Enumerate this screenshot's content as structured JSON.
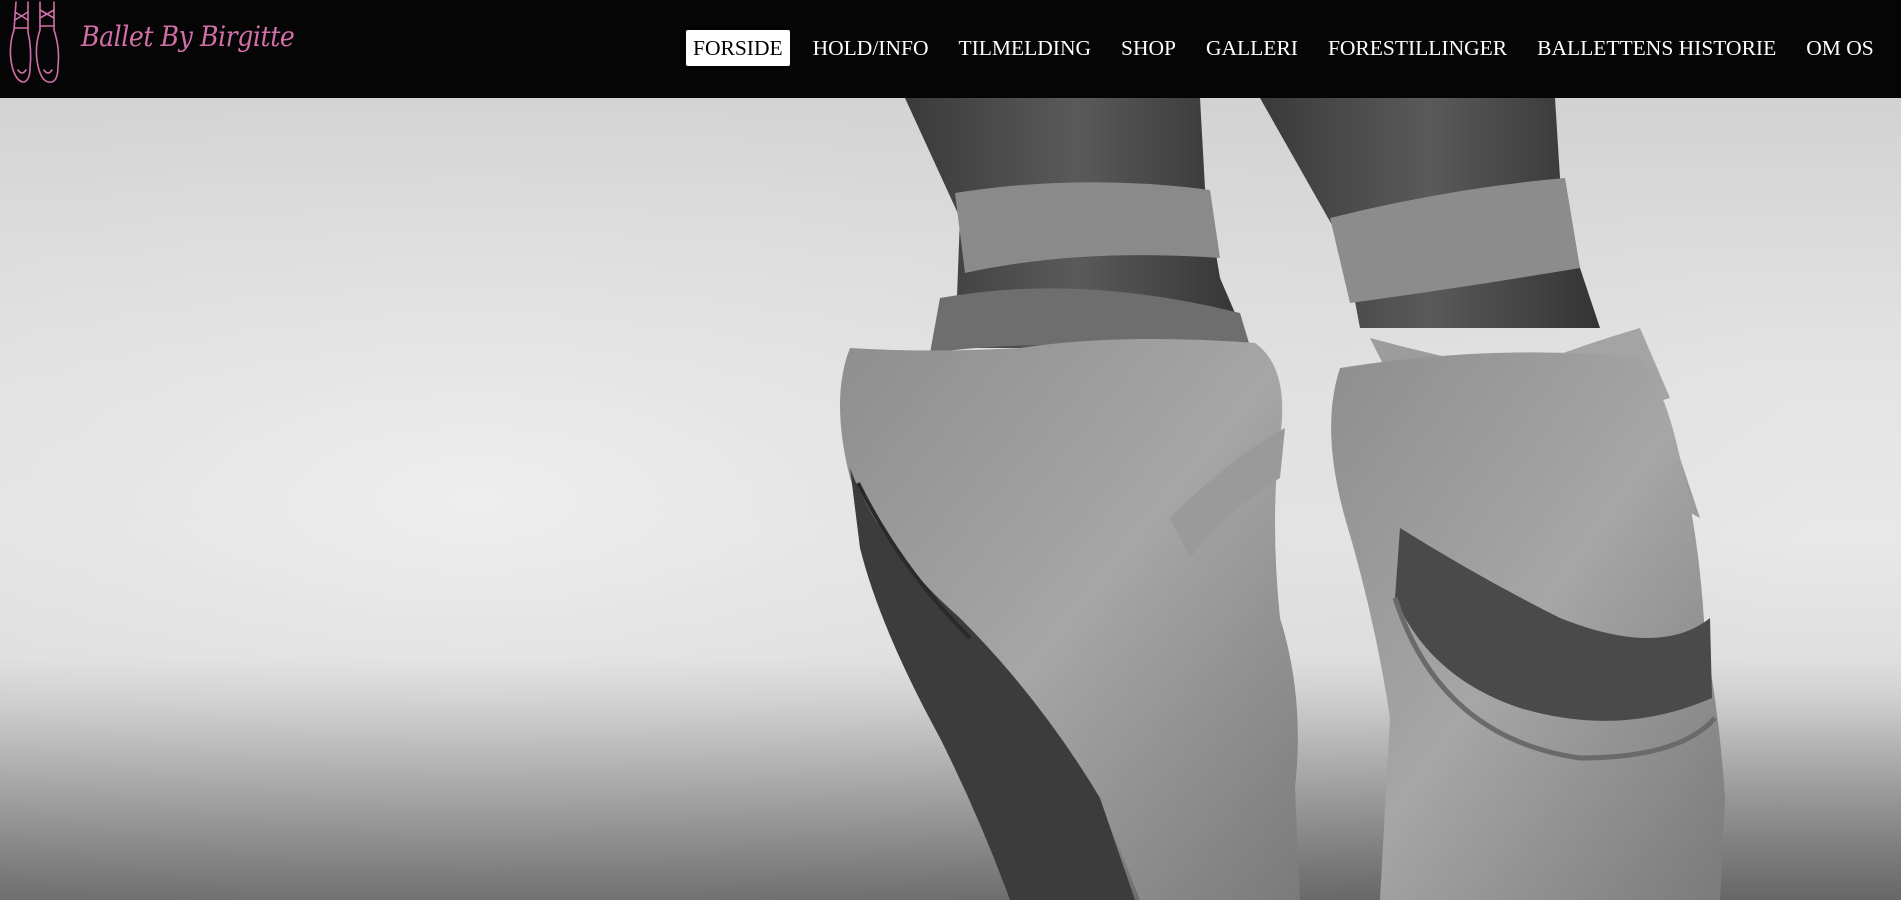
{
  "brand": {
    "name": "Ballet By Birgitte",
    "logo_icon": "pointe-shoes-icon",
    "accent_color": "#d36fa8"
  },
  "nav": {
    "active_index": 0,
    "items": [
      {
        "label": "FORSIDE"
      },
      {
        "label": "HOLD/INFO"
      },
      {
        "label": "TILMELDING"
      },
      {
        "label": "SHOP"
      },
      {
        "label": "GALLERI"
      },
      {
        "label": "FORESTILLINGER"
      },
      {
        "label": "BALLETTENS HISTORIE"
      },
      {
        "label": "OM OS"
      }
    ]
  },
  "hero": {
    "image": "black-and-white photo of ballet dancer feet in pointe shoes"
  },
  "colors": {
    "header_bg": "#050505",
    "nav_text": "#ffffff",
    "nav_active_bg": "#ffffff",
    "nav_active_text": "#000000"
  }
}
